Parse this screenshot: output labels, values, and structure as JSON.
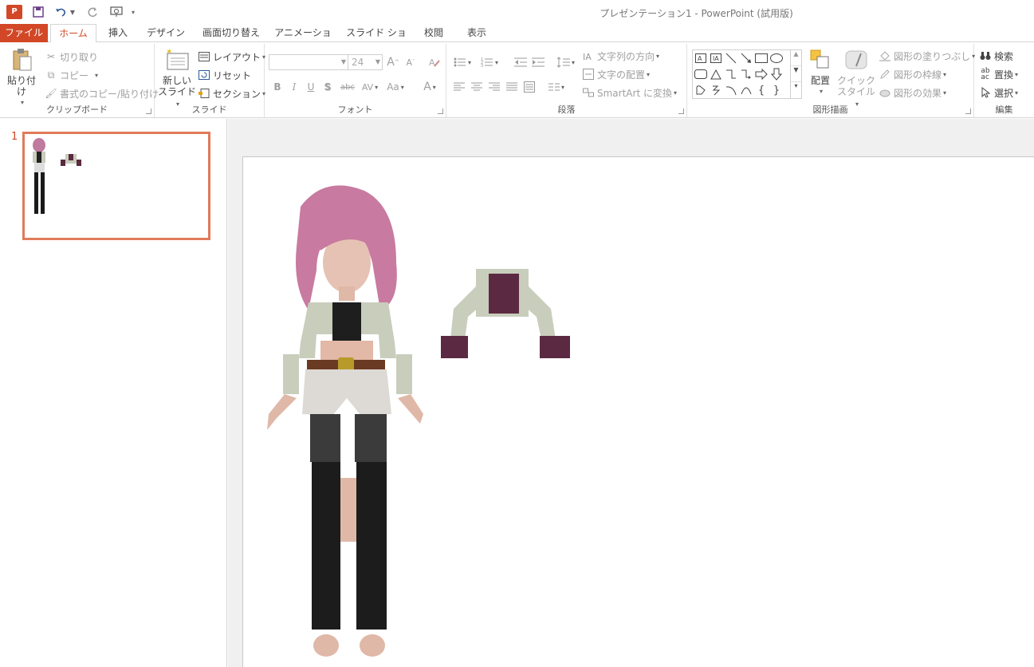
{
  "app": {
    "logo": "P",
    "window_title": "プレゼンテーション1 - PowerPoint (試用版)"
  },
  "tabs": [
    {
      "label": "ファイル"
    },
    {
      "label": "ホーム"
    },
    {
      "label": "挿入"
    },
    {
      "label": "デザイン"
    },
    {
      "label": "画面切り替え"
    },
    {
      "label": "アニメーション"
    },
    {
      "label": "スライド ショー"
    },
    {
      "label": "校閲"
    },
    {
      "label": "表示"
    }
  ],
  "ribbon": {
    "clipboard": {
      "label": "クリップボード",
      "paste": "貼り付け",
      "cut": "切り取り",
      "copy": "コピー",
      "format_painter": "書式のコピー/貼り付け"
    },
    "slides": {
      "label": "スライド",
      "new_slide_line1": "新しい",
      "new_slide_line2": "スライド",
      "layout": "レイアウト",
      "reset": "リセット",
      "section": "セクション"
    },
    "font": {
      "label": "フォント",
      "font_name": "",
      "font_size": "24",
      "bold": "B",
      "italic": "I",
      "underline": "U",
      "shadow": "S",
      "strike": "abc",
      "spacing": "AV",
      "case": "Aa",
      "color": "A",
      "grow": "A",
      "shrink": "A"
    },
    "paragraph": {
      "label": "段落",
      "text_direction": "文字列の方向",
      "align_text": "文字の配置",
      "smartart": "SmartArt に変換"
    },
    "drawing": {
      "label": "図形描画",
      "arrange": "配置",
      "quick_styles_line1": "クイック",
      "quick_styles_line2": "スタイル",
      "shape_fill": "図形の塗りつぶし",
      "shape_outline": "図形の枠線",
      "shape_effects": "図形の効果"
    },
    "editing": {
      "label": "編集",
      "find": "検索",
      "replace": "置換",
      "select": "選択"
    }
  },
  "thumbnails": [
    {
      "number": "1"
    }
  ],
  "colors": {
    "accent": "#d24726",
    "thumb_border": "#e07b5a"
  }
}
